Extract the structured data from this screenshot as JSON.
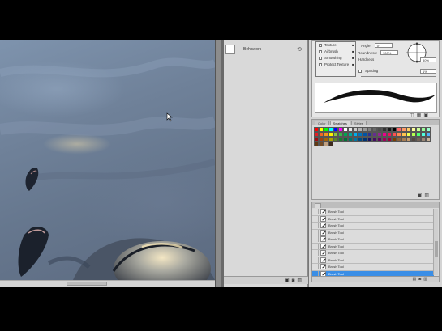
{
  "history": {
    "item_label": "Behaviors",
    "footer_icons": [
      "brush-icon",
      "camera-icon",
      "trash-icon"
    ]
  },
  "brush": {
    "options": [
      "Texture",
      "Airbrush",
      "Smoothing",
      "Protect Texture"
    ],
    "angle_label": "Angle:",
    "angle_value": "0°",
    "roundness_label": "Roundness:",
    "roundness_value": "100%",
    "hardness_label": "Hardness",
    "hardness_value": "80%",
    "spacing_label": "Spacing",
    "spacing_value": "1%"
  },
  "swatches": {
    "tabs": [
      "Color",
      "Swatches",
      "Styles"
    ],
    "colors": [
      "#ff0000",
      "#ffff00",
      "#00ff00",
      "#00ffff",
      "#0000ff",
      "#ff00ff",
      "#ffffff",
      "#e6e6e6",
      "#cccccc",
      "#b3b3b3",
      "#999999",
      "#808080",
      "#666666",
      "#4d4d4d",
      "#333333",
      "#1a1a1a",
      "#000000",
      "#ff6666",
      "#ff9966",
      "#ffcc66",
      "#ffff99",
      "#ccff99",
      "#99ff99",
      "#99ffcc",
      "#e31e24",
      "#f26522",
      "#f7941d",
      "#fff200",
      "#8dc63f",
      "#39b54a",
      "#00a651",
      "#00a99d",
      "#00aeef",
      "#0072bc",
      "#0054a6",
      "#2e3192",
      "#662d91",
      "#92278f",
      "#ec008c",
      "#ed145b",
      "#ff4f4f",
      "#ff884f",
      "#ffc24f",
      "#f2ff4f",
      "#b3ff4f",
      "#4fff72",
      "#4fffdd",
      "#4fb3ff",
      "#9e0b0f",
      "#a0410d",
      "#a36209",
      "#aba000",
      "#598527",
      "#197b30",
      "#007236",
      "#00746b",
      "#0076a3",
      "#004b80",
      "#003471",
      "#1b1464",
      "#440e62",
      "#630460",
      "#9e005d",
      "#9e0039",
      "#7b3f00",
      "#8c6239",
      "#a67c52",
      "#c69c6d",
      "#534741",
      "#736357",
      "#998675",
      "#c7b299",
      "#603913",
      "#754c24",
      "#c0a080",
      "#3c2a1e"
    ]
  },
  "layers": {
    "items": [
      "Brush Tool",
      "Brush Tool",
      "Brush Tool",
      "Brush Tool",
      "Brush Tool",
      "Brush Tool",
      "Brush Tool",
      "Brush Tool",
      "Brush Tool",
      "Brush Tool"
    ],
    "selected_index": 9,
    "footer_icons": [
      "snapshot-icon",
      "new-icon",
      "trash-icon"
    ]
  }
}
